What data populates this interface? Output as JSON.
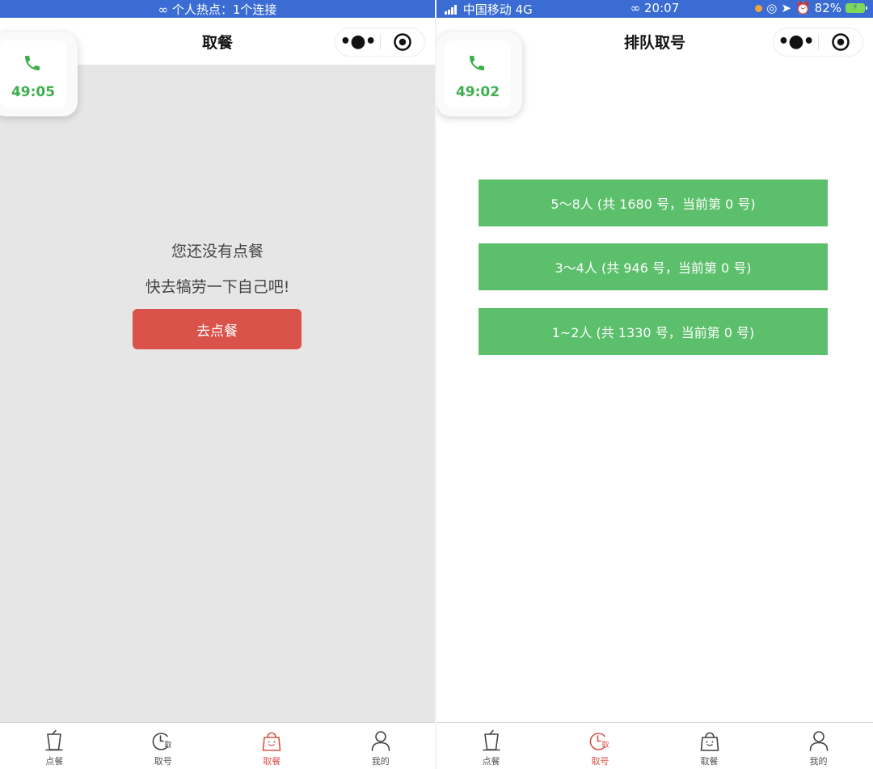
{
  "left_screen": {
    "statusbar": {
      "center_text": "个人热点：1个连接"
    },
    "navbar": {
      "title": "取餐",
      "more_symbol": "•●•"
    },
    "call": {
      "timer": "49:05"
    },
    "empty": {
      "line1": "您还没有点餐",
      "line2": "快去犒劳一下自己吧!"
    },
    "order_button": "去点餐",
    "tabs": [
      {
        "label": "点餐",
        "icon": "cup-icon",
        "active": false
      },
      {
        "label": "取号",
        "icon": "clock-ticket-icon",
        "active": false
      },
      {
        "label": "取餐",
        "icon": "bag-icon",
        "active": true
      },
      {
        "label": "我的",
        "icon": "user-icon",
        "active": false
      }
    ]
  },
  "right_screen": {
    "statusbar": {
      "carrier": "中国移动 4G",
      "time": "20:07",
      "battery": "82%"
    },
    "navbar": {
      "title": "排队取号",
      "more_symbol": "•●•"
    },
    "call": {
      "timer": "49:02"
    },
    "queue_options": [
      "5～8人 (共 1680 号，当前第 0 号)",
      "3～4人 (共 946 号，当前第 0 号)",
      "1~2人 (共 1330 号，当前第 0 号)"
    ],
    "tabs": [
      {
        "label": "点餐",
        "icon": "cup-icon",
        "active": false
      },
      {
        "label": "取号",
        "icon": "clock-ticket-icon",
        "active": true
      },
      {
        "label": "取餐",
        "icon": "bag-icon",
        "active": false
      },
      {
        "label": "我的",
        "icon": "user-icon",
        "active": false
      }
    ]
  },
  "colors": {
    "statusbar_blue": "#3a6cd3",
    "accent_red": "#d9534a",
    "accent_green": "#5bbf6b",
    "call_green": "#3fae4d",
    "left_background": "#e6e6e6"
  }
}
